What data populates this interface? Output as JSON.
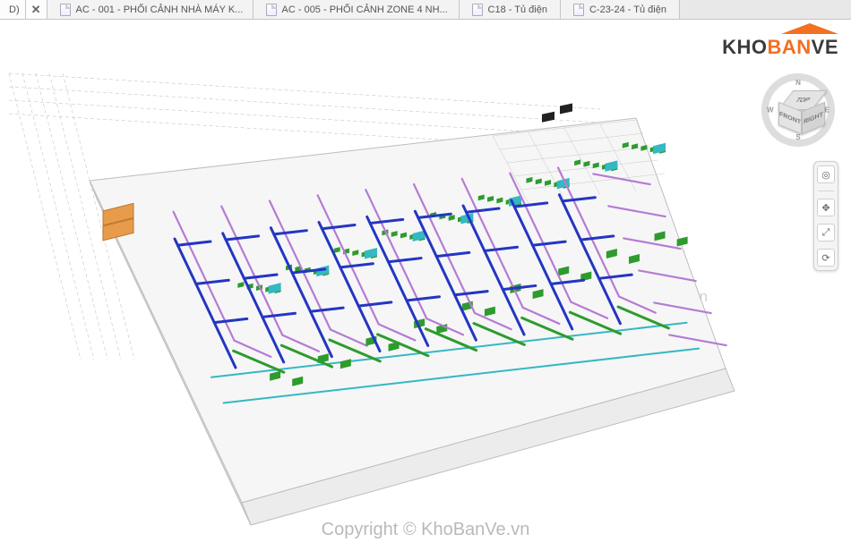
{
  "tabs": {
    "fragment": "D)",
    "items": [
      {
        "label": "AC - 001 - PHỐI CẢNH NHÀ MÁY K...",
        "active": false
      },
      {
        "label": "AC - 005 - PHỐI CẢNH ZONE 4 NH...",
        "active": false
      },
      {
        "label": "C18 - Tủ điện",
        "active": false
      },
      {
        "label": "C-23-24 - Tủ điện",
        "active": false
      }
    ]
  },
  "logo": {
    "prefix": "KHO",
    "middle": "BAN",
    "suffix": "VE"
  },
  "viewcube": {
    "faces": {
      "top": "TOP",
      "front": "FRONT",
      "right": "RIGHT"
    },
    "compass": {
      "n": "N",
      "s": "S",
      "e": "E",
      "w": "W"
    }
  },
  "navbar": {
    "wheel": "◎",
    "pan": "✥",
    "zoom": "⤢",
    "orbit": "⟳"
  },
  "watermark": {
    "main": "Copyright © KhoBanVe.vn",
    "side": "KhoBanVe.vn"
  }
}
